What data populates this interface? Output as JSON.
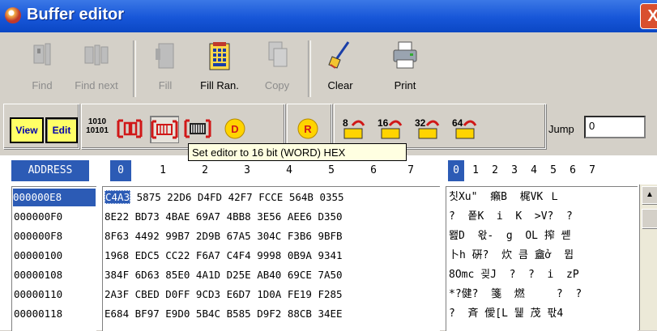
{
  "window": {
    "title": "Buffer editor",
    "close_label": "X"
  },
  "toolbar": {
    "find": "Find",
    "find_next": "Find next",
    "fill": "Fill",
    "fill_random": "Fill Ran.",
    "copy": "Copy",
    "clear": "Clear",
    "print": "Print"
  },
  "modes": {
    "view": "View",
    "edit": "Edit",
    "binary": "1010\n10101",
    "d_label": "D",
    "r_label": "R",
    "b8": "8",
    "b16": "16",
    "b32": "32",
    "b64": "64"
  },
  "jump": {
    "label": "Jump",
    "value": "0"
  },
  "tooltip": "Set editor to 16 bit (WORD) HEX",
  "grid": {
    "address_header": "ADDRESS",
    "hex_columns": [
      "0",
      "1",
      "2",
      "3",
      "4",
      "5",
      "6",
      "7"
    ],
    "text_columns": [
      "0",
      "1",
      "2",
      "3",
      "4",
      "5",
      "6",
      "7"
    ],
    "addresses": [
      "000000E8",
      "000000F0",
      "000000F8",
      "00000100",
      "00000108",
      "00000110",
      "00000118"
    ],
    "hex_rows": [
      [
        "C4A3",
        "5875",
        "22D6",
        "D4FD",
        "42F7",
        "FCCE",
        "564B",
        "0355"
      ],
      [
        "8E22",
        "BD73",
        "4BAE",
        "69A7",
        "4BB8",
        "3E56",
        "AEE6",
        "D350"
      ],
      [
        "8F63",
        "4492",
        "99B7",
        "2D9B",
        "67A5",
        "304C",
        "F3B6",
        "9BFB"
      ],
      [
        "1968",
        "EDC5",
        "CC22",
        "F6A7",
        "C4F4",
        "9998",
        "0B9A",
        "9341"
      ],
      [
        "384F",
        "6D63",
        "85E0",
        "4A1D",
        "D25E",
        "AB40",
        "69CE",
        "7A50"
      ],
      [
        "2A3F",
        "CBED",
        "D0FF",
        "9CD3",
        "E6D7",
        "1D0A",
        "FE19",
        "F285"
      ],
      [
        "E684",
        "BF97",
        "E9D0",
        "5B4C",
        "B585",
        "D9F2",
        "88CB",
        "34EE"
      ]
    ],
    "text_rows": [
      "칫Xu\"  癩B  梶VK Ｌ",
      "?  퐅K  i  K  >V?  ?",
      "뫮D  왃-  g  OL 搾 쏃",
      "卜h 硏?  炊 큼 盦ở  뮙",
      "8Omc 굊J  ?  ?  i  zP",
      "*?健?  箋  燃     ?  ?",
      "?  斉 僾[L 뒕 茂 팏4"
    ]
  }
}
